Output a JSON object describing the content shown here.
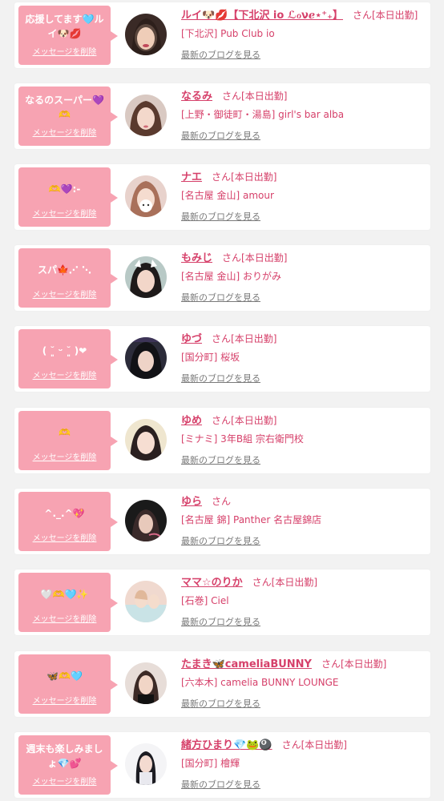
{
  "delete_label": "メッセージを削除",
  "blog_label": "最新のブログを見る",
  "san_label": "さん",
  "colors": {
    "accent": "#d6406a",
    "bubble": "#f7a3b2",
    "muted": "#7a7a7a"
  },
  "entries": [
    {
      "message": "応援してます🩵ルイ🐶💋",
      "name": "ルイ🐶💋【下北沢 io ℒℴνℯ⋆⁺₊】",
      "status": "[本日出勤]",
      "shop": "[下北沢] Pub Club io"
    },
    {
      "message": "なるのスーパー💜🫶",
      "name": "なるみ",
      "status": "[本日出勤]",
      "shop": "[上野・御徒町・湯島] girl's bar alba"
    },
    {
      "message": "🫶💜:-",
      "name": "ナエ",
      "status": "[本日出勤]",
      "shop": "[名古屋 金山] amour"
    },
    {
      "message": "スパ🍁⋰ ⋱",
      "name": "もみじ",
      "status": "[本日出勤]",
      "shop": "[名古屋 金山] おりがみ"
    },
    {
      "message": "( ˘͈ ᵕ ˘͈ )❤",
      "name": "ゆづ",
      "status": "[本日出勤]",
      "shop": "[国分町] 桜坂"
    },
    {
      "message": "🫶",
      "name": "ゆめ",
      "status": "[本日出勤]",
      "shop": "[ミナミ] 3年B組 宗右衛門校"
    },
    {
      "message": "^._.^💖",
      "name": "ゆら",
      "status": "",
      "shop": "[名古屋 錦] Panther 名古屋錦店"
    },
    {
      "message": "🤍🫶🩵✨",
      "name": "ママ☆のりか",
      "status": "[本日出勤]",
      "shop": "[石巻] Ciel"
    },
    {
      "message": "🦋🫶🩵",
      "name": "たまき🦋cameliaBUNNY",
      "status": "[本日出勤]",
      "shop": "[六本木] camelia BUNNY LOUNGE"
    },
    {
      "message": "週末も楽しみましょ💎💕",
      "name": "緒方ひまり💎🐸🎱",
      "status": "[本日出勤]",
      "shop": "[国分町] 檜輝"
    }
  ]
}
